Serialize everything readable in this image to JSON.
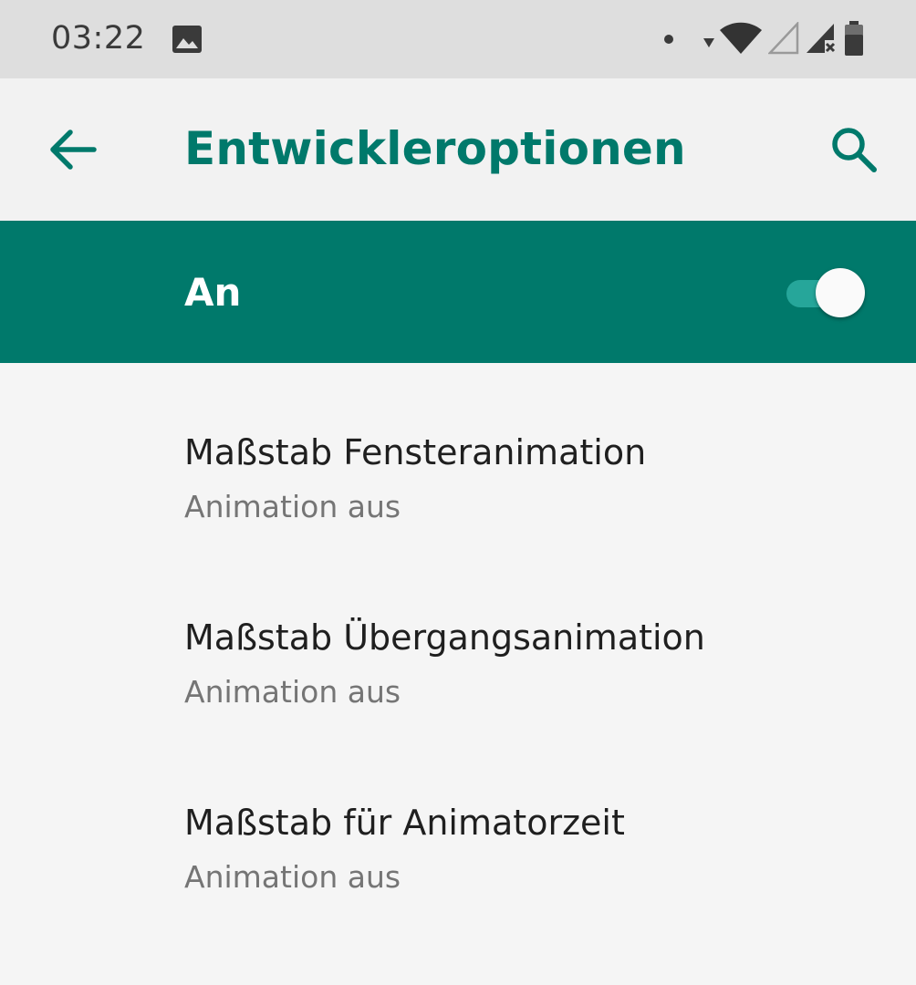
{
  "status_bar": {
    "time": "03:22",
    "icons": [
      "image-notification-icon",
      "dot-notification-icon",
      "data-arrow-icon",
      "wifi-icon",
      "signal-empty-icon",
      "signal-no-service-icon",
      "battery-icon"
    ]
  },
  "app_bar": {
    "title": "Entwickleroptionen",
    "back_icon": "arrow-back-icon",
    "search_icon": "search-icon"
  },
  "master_switch": {
    "label": "An",
    "checked": true
  },
  "settings": [
    {
      "title": "Maßstab Fensteranimation",
      "summary": "Animation aus"
    },
    {
      "title": "Maßstab Übergangsanimation",
      "summary": "Animation aus"
    },
    {
      "title": "Maßstab für Animatorzeit",
      "summary": "Animation aus"
    }
  ],
  "colors": {
    "accent": "#00796b",
    "status_bar_bg": "#dedede",
    "app_bar_bg": "#f2f2f2",
    "list_bg": "#f5f5f5"
  }
}
